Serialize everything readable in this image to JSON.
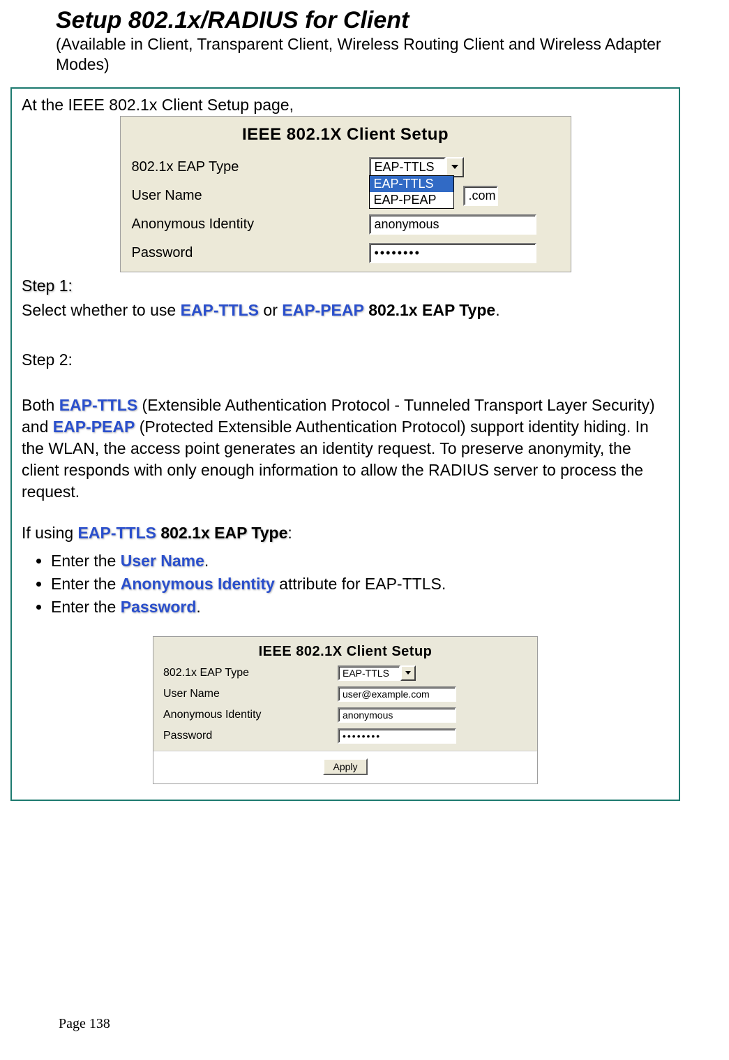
{
  "title": "Setup 802.1x/RADIUS for Client",
  "subtitle": "(Available in Client, Transparent Client, Wireless Routing Client and Wireless Adapter Modes)",
  "intro": "At the IEEE 802.1x Client Setup page,",
  "shot1": {
    "title": "IEEE 802.1X Client Setup",
    "labels": {
      "eapType": "802.1x EAP Type",
      "userName": "User Name",
      "anonId": "Anonymous Identity",
      "password": "Password"
    },
    "values": {
      "eapSelected": "EAP-TTLS",
      "options": [
        "EAP-TTLS",
        "EAP-PEAP"
      ],
      "userFragment": ".com",
      "anonId": "anonymous",
      "password": "••••••••"
    }
  },
  "step1_label": "Step 1:",
  "step1_a": "Select whether to use ",
  "step1_ttls": "EAP-TTLS",
  "step1_b": " or ",
  "step1_peap": "EAP-PEAP",
  "step1_c": " ",
  "step1_d": "802.1x EAP Type",
  "step1_e": ".",
  "step2_label": "Step 2:",
  "para2_a": "Both ",
  "para2_ttls": "EAP-TTLS",
  "para2_b": " (Extensible Authentication Protocol - Tunneled Transport Layer Security) and ",
  "para2_peap": "EAP-PEAP",
  "para2_c": " (Protected Extensible Authentication Protocol) support identity hiding. In the WLAN, the access point generates an identity request. To preserve anonymity, the client responds with only enough information to allow the RADIUS server to process the request.",
  "ifusing_a": "If using ",
  "ifusing_ttls": "EAP-TTLS",
  "ifusing_b": " ",
  "ifusing_c": "802.1x EAP Type",
  "ifusing_d": ":",
  "bullet1_a": "Enter the ",
  "bullet1_b": "User Name",
  "bullet1_c": ".",
  "bullet2_a": "Enter the ",
  "bullet2_b": "Anonymous Identity",
  "bullet2_c": " attribute for EAP-TTLS.",
  "bullet3_a": "Enter the ",
  "bullet3_b": "Password",
  "bullet3_c": ".",
  "shot2": {
    "title": "IEEE 802.1X Client Setup",
    "labels": {
      "eapType": "802.1x EAP Type",
      "userName": "User Name",
      "anonId": "Anonymous Identity",
      "password": "Password"
    },
    "values": {
      "eapSelected": "EAP-TTLS",
      "userName": "user@example.com",
      "anonId": "anonymous",
      "password": "••••••••"
    },
    "applyLabel": "Apply"
  },
  "footer": "Page 138"
}
